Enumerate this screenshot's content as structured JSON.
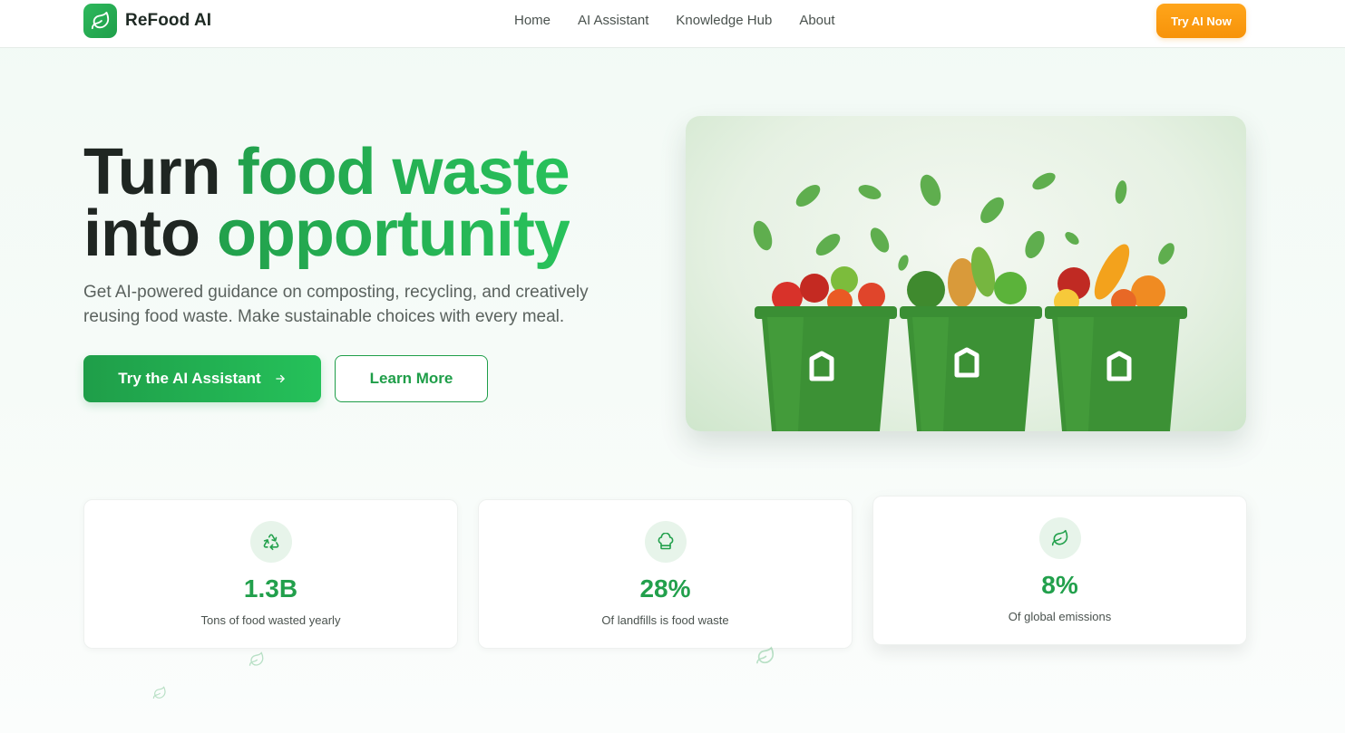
{
  "header": {
    "brand": "ReFood AI",
    "nav": [
      "Home",
      "AI Assistant",
      "Knowledge Hub",
      "About"
    ],
    "cta": "Try AI Now"
  },
  "hero": {
    "title_part1": "Turn ",
    "title_accent1": "food waste",
    "title_part2": "into ",
    "title_accent2": "opportunity",
    "subtitle": "Get AI-powered guidance on composting, recycling, and creatively reusing food waste. Make sustainable choices with every meal.",
    "primary_button": "Try the AI Assistant",
    "secondary_button": "Learn More"
  },
  "stats": [
    {
      "icon": "recycle-icon",
      "value": "1.3B",
      "label": "Tons of food wasted yearly"
    },
    {
      "icon": "chef-hat-icon",
      "value": "28%",
      "label": "Of landfills is food waste"
    },
    {
      "icon": "leaf-icon",
      "value": "8%",
      "label": "Of global emissions"
    }
  ],
  "colors": {
    "brand_green": "#22a04c",
    "cta_orange": "#f7930a"
  }
}
